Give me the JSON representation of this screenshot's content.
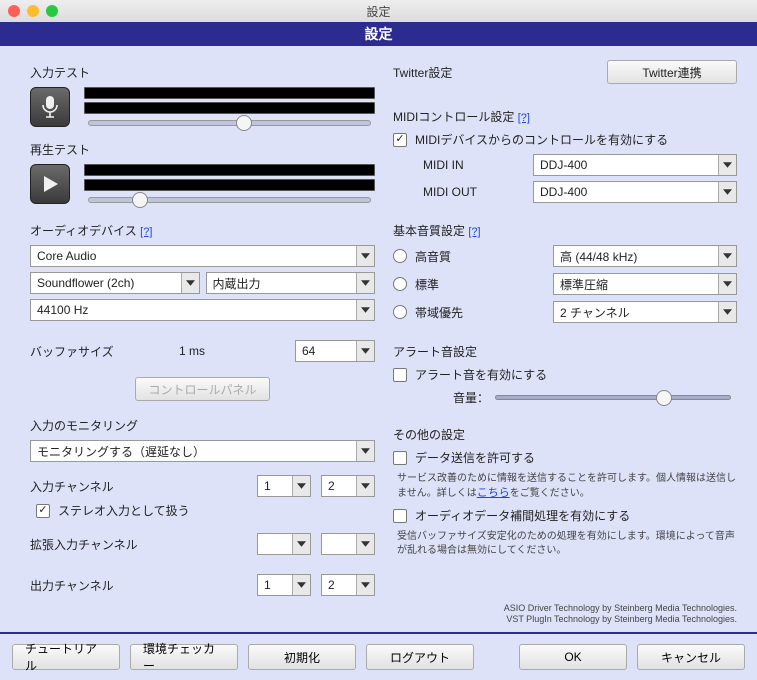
{
  "window": {
    "title": "設定"
  },
  "header": {
    "title": "設定"
  },
  "left": {
    "input_test": "入力テスト",
    "playback_test": "再生テスト",
    "audio_device_label": "オーディオデバイス",
    "help": "[?]",
    "device": "Core Audio",
    "input_device": "Soundflower (2ch)",
    "output_device": "内蔵出力",
    "sample_rate": "44100 Hz",
    "buffer_label": "バッファサイズ",
    "buffer_latency": "1 ms",
    "buffer_value": "64",
    "control_panel": "コントロールパネル",
    "monitoring_label": "入力のモニタリング",
    "monitoring_value": "モニタリングする（遅延なし）",
    "input_ch_label": "入力チャンネル",
    "input_ch1": "1",
    "input_ch2": "2",
    "stereo_check": "ステレオ入力として扱う",
    "ext_input_ch_label": "拡張入力チャンネル",
    "output_ch_label": "出力チャンネル",
    "output_ch1": "1",
    "output_ch2": "2"
  },
  "right": {
    "twitter_label": "Twitter設定",
    "twitter_btn": "Twitter連携",
    "midi_label": "MIDIコントロール設定",
    "midi_help": "[?]",
    "midi_enable": "MIDIデバイスからのコントロールを有効にする",
    "midi_in_label": "MIDI IN",
    "midi_in_value": "DDJ-400",
    "midi_out_label": "MIDI OUT",
    "midi_out_value": "DDJ-400",
    "quality_label": "基本音質設定",
    "quality_help": "[?]",
    "q_high": "高音質",
    "q_high_val": "高 (44/48 kHz)",
    "q_std": "標準",
    "q_std_val": "標準圧縮",
    "q_band": "帯域優先",
    "q_band_val": "2 チャンネル",
    "alert_label": "アラート音設定",
    "alert_enable": "アラート音を有効にする",
    "alert_volume": "音量：",
    "other_label": "その他の設定",
    "data_send": "データ送信を許可する",
    "data_send_desc1": "サービス改善のために情報を送信することを許可します。個人情報は送信しません。詳しくは",
    "data_send_link": "こちら",
    "data_send_desc2": "をご覧ください。",
    "audio_comp": "オーディオデータ補間処理を有効にする",
    "audio_comp_desc": "受信バッファサイズ安定化のための処理を有効にします。環境によって音声が乱れる場合は無効にしてください。",
    "credit1": "ASIO Driver Technology by Steinberg Media Technologies.",
    "credit2": "VST PlugIn Technology by Steinberg Media Technologies."
  },
  "footer": {
    "tutorial": "チュートリアル",
    "checker": "環境チェッカー",
    "reset": "初期化",
    "logout": "ログアウト",
    "ok": "OK",
    "cancel": "キャンセル"
  }
}
